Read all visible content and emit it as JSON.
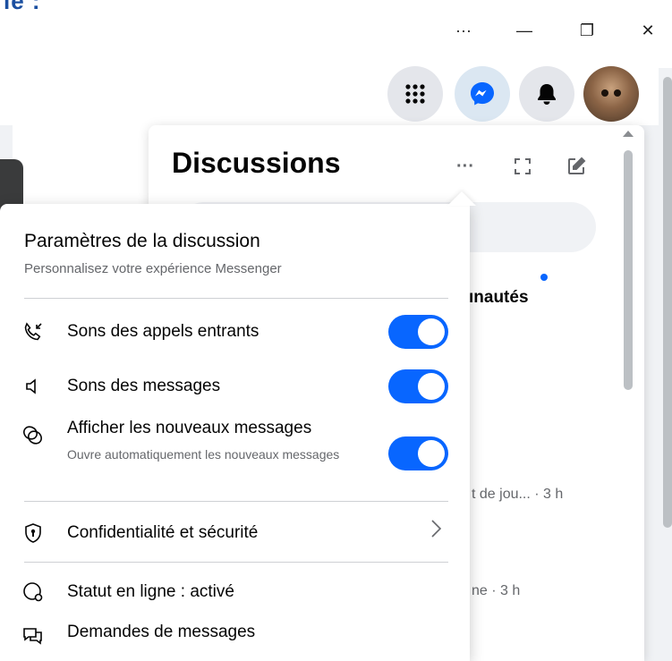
{
  "page_fragment": "ie :",
  "window_controls": {
    "more": "···",
    "minimize": "—",
    "restore": "❐",
    "close": "✕"
  },
  "header": {
    "menu_icon": "grid-icon",
    "messenger_icon": "messenger-icon",
    "notifications_icon": "bell-icon"
  },
  "discussions": {
    "title": "Discussions",
    "options_icon": "···",
    "tab_fragment": "ınautés",
    "row1_fragment": "t de jou... · 3 h",
    "row2_fragment": "ne · 3 h"
  },
  "settings": {
    "title": "Paramètres de la discussion",
    "subtitle": "Personnalisez votre expérience Messenger",
    "items": [
      {
        "label": "Sons des appels entrants",
        "toggle_on": true,
        "icon": "incoming-call-icon"
      },
      {
        "label": "Sons des messages",
        "toggle_on": true,
        "icon": "speaker-icon"
      },
      {
        "label": "Afficher les nouveaux messages",
        "sub": "Ouvre automatiquement les nouveaux messages",
        "toggle_on": true,
        "icon": "chat-bubbles-icon"
      },
      {
        "label": "Confidentialité et sécurité",
        "icon": "shield-icon"
      },
      {
        "label": "Statut en ligne : activé",
        "icon": "online-status-icon"
      },
      {
        "label": "Demandes de messages",
        "icon": "message-requests-icon"
      }
    ]
  },
  "colors": {
    "accent": "#0866ff",
    "muted": "#65676b"
  }
}
